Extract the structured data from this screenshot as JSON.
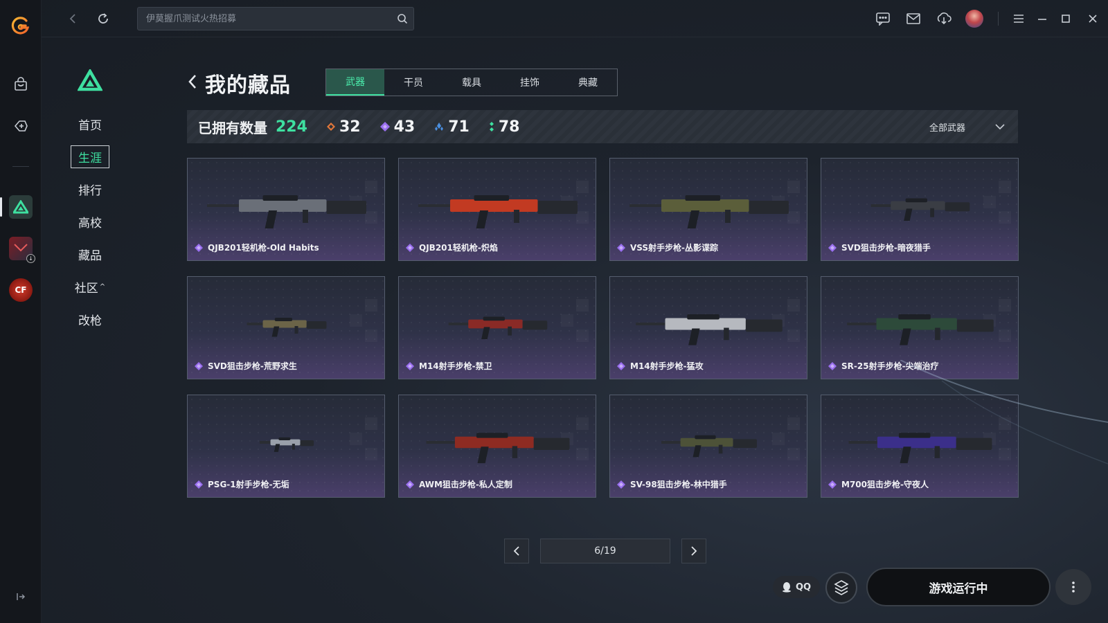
{
  "search": {
    "placeholder": "伊莫握爪测试火热招募"
  },
  "page": {
    "title": "我的藏品"
  },
  "subnav": {
    "items": [
      {
        "label": "首页"
      },
      {
        "label": "生涯"
      },
      {
        "label": "排行"
      },
      {
        "label": "高校"
      },
      {
        "label": "藏品"
      },
      {
        "label": "社区"
      },
      {
        "label": "改枪"
      }
    ],
    "active": "生涯"
  },
  "tabs": [
    {
      "label": "武器"
    },
    {
      "label": "干员"
    },
    {
      "label": "载具"
    },
    {
      "label": "挂饰"
    },
    {
      "label": "典藏"
    }
  ],
  "stats": {
    "label": "已拥有数量",
    "total": "224",
    "rarities": [
      {
        "count": "32",
        "color": "#e0763a"
      },
      {
        "count": "43",
        "color": "#9a6ff0"
      },
      {
        "count": "71",
        "color": "#4a8fe0"
      },
      {
        "count": "78",
        "color": "#3ee0a0"
      }
    ],
    "filter": "全部武器"
  },
  "items": [
    {
      "name": "QJB201轻机枪-Old Habits",
      "accent": "#6a6f78"
    },
    {
      "name": "QJB201轻机枪-炽焰",
      "accent": "#c23a22"
    },
    {
      "name": "VSS射手步枪-丛影谍踪",
      "accent": "#5b5e3a"
    },
    {
      "name": "SVD狙击步枪-暗夜猎手",
      "accent": "#3a3d44"
    },
    {
      "name": "SVD狙击步枪-荒野求生",
      "accent": "#6b6448"
    },
    {
      "name": "M14射手步枪-禁卫",
      "accent": "#8a2a26"
    },
    {
      "name": "M14射手步枪-猛攻",
      "accent": "#b6b9bf"
    },
    {
      "name": "SR-25射手步枪-尖端治疗",
      "accent": "#2d4a3a"
    },
    {
      "name": "PSG-1射手步枪-无垢",
      "accent": "#9aa0aa"
    },
    {
      "name": "AWM狙击步枪-私人定制",
      "accent": "#8e2b22"
    },
    {
      "name": "SV-98狙击步枪-林中猎手",
      "accent": "#4d5238"
    },
    {
      "name": "M700狙击步枪-守夜人",
      "accent": "#3b2f8a"
    }
  ],
  "pagination": {
    "indicator": "6/19"
  },
  "footer": {
    "qq_label": "QQ",
    "run_label": "游戏运行中"
  }
}
